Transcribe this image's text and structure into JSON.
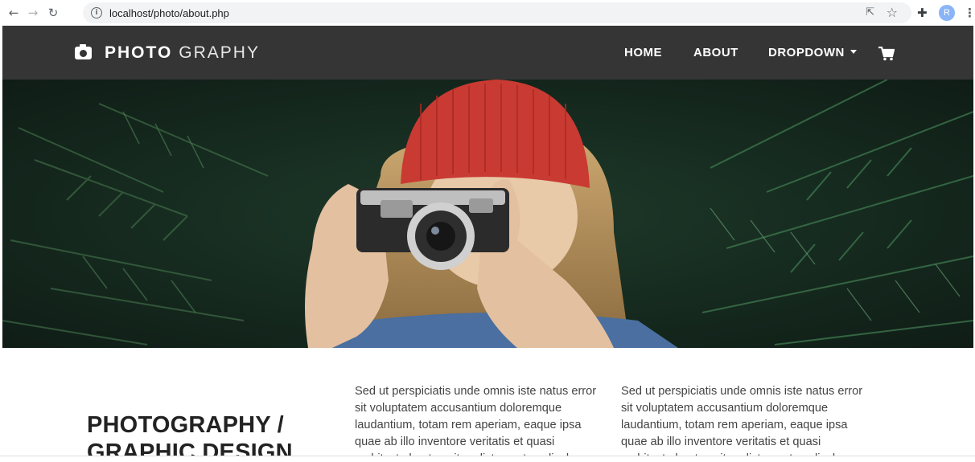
{
  "browser": {
    "url": "localhost/photo/about.php",
    "avatar_letter": "R"
  },
  "navbar": {
    "brand_bold": "PHOTO",
    "brand_thin": "GRAPHY",
    "items": [
      {
        "label": "HOME"
      },
      {
        "label": "ABOUT"
      },
      {
        "label": "DROPDOWN"
      }
    ],
    "background": "#353535"
  },
  "hero": {
    "description": "photo of woman in red beanie holding a vintage camera among pine branches"
  },
  "content": {
    "heading_line1": "PHOTOGRAPHY /",
    "heading_line2": "GRAPHIC DESIGN",
    "paragraph1": "Sed ut perspiciatis unde omnis iste natus error sit voluptatem accusantium doloremque laudantium, totam rem aperiam, eaque ipsa quae ab illo inventore veritatis et quasi architecto beatae vitae dicta sunt explicabo.",
    "paragraph2": "Sed ut perspiciatis unde omnis iste natus error sit voluptatem accusantium doloremque laudantium, totam rem aperiam, eaque ipsa quae ab illo inventore veritatis et quasi architecto beatae vitae dicta sunt explicabo."
  }
}
